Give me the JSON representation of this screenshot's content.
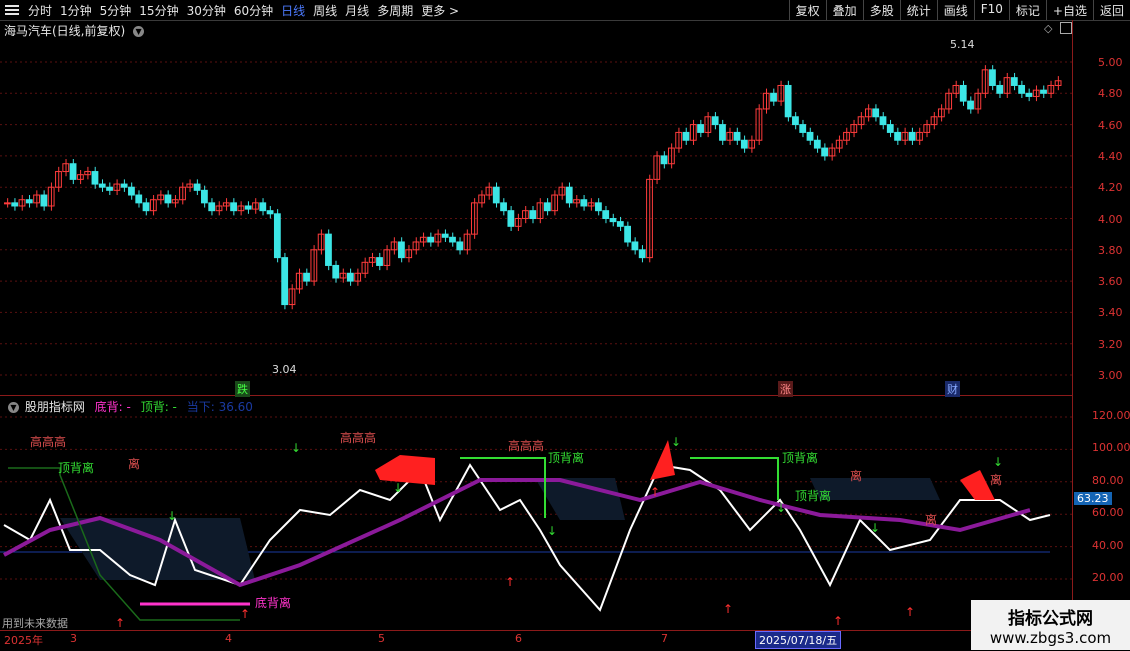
{
  "toolbar": {
    "periods": [
      "分时",
      "1分钟",
      "5分钟",
      "15分钟",
      "30分钟",
      "60分钟",
      "日线",
      "周线",
      "月线",
      "多周期",
      "更多 >"
    ],
    "active_period": "日线",
    "tools": [
      "复权",
      "叠加",
      "多股",
      "统计",
      "画线",
      "F10",
      "标记",
      "+自选",
      "返回"
    ]
  },
  "main_panel": {
    "title": "海马汽车(日线,前复权)",
    "high_label": "5.14",
    "low_label": "3.04",
    "price_ticks": [
      "5.00",
      "4.80",
      "4.60",
      "4.40",
      "4.20",
      "4.00",
      "3.80",
      "3.60",
      "3.40",
      "3.20",
      "3.00"
    ],
    "markers": [
      "跌",
      "涨",
      "财"
    ]
  },
  "indicator_panel": {
    "name": "股朋指标网",
    "legend_bottom": "底背: -",
    "legend_top": "顶背: -",
    "legend_extra": "当下: 36.60",
    "ticks": [
      "120.00",
      "100.00",
      "80.00",
      "60.00",
      "40.00",
      "20.00"
    ],
    "current_value": "63.23",
    "annotations": [
      "高高高",
      "高高高",
      "高高高",
      "顶背离",
      "顶背离",
      "顶背离",
      "顶背离",
      "底背离",
      "离",
      "离",
      "离",
      "离",
      "用到未来数据"
    ]
  },
  "footer": {
    "year": "2025年",
    "months": [
      "3",
      "4",
      "5",
      "6",
      "7",
      "8"
    ],
    "selected_date": "2025/07/18/五"
  },
  "watermark": {
    "title": "指标公式网",
    "url": "www.zbgs3.com"
  },
  "colors": {
    "up": "#ff3c3c",
    "down": "#3ce6e6",
    "white_line": "#ffffff",
    "purple": "#8b1a9a",
    "green": "#33dd33",
    "magenta": "#ff33cc"
  }
}
